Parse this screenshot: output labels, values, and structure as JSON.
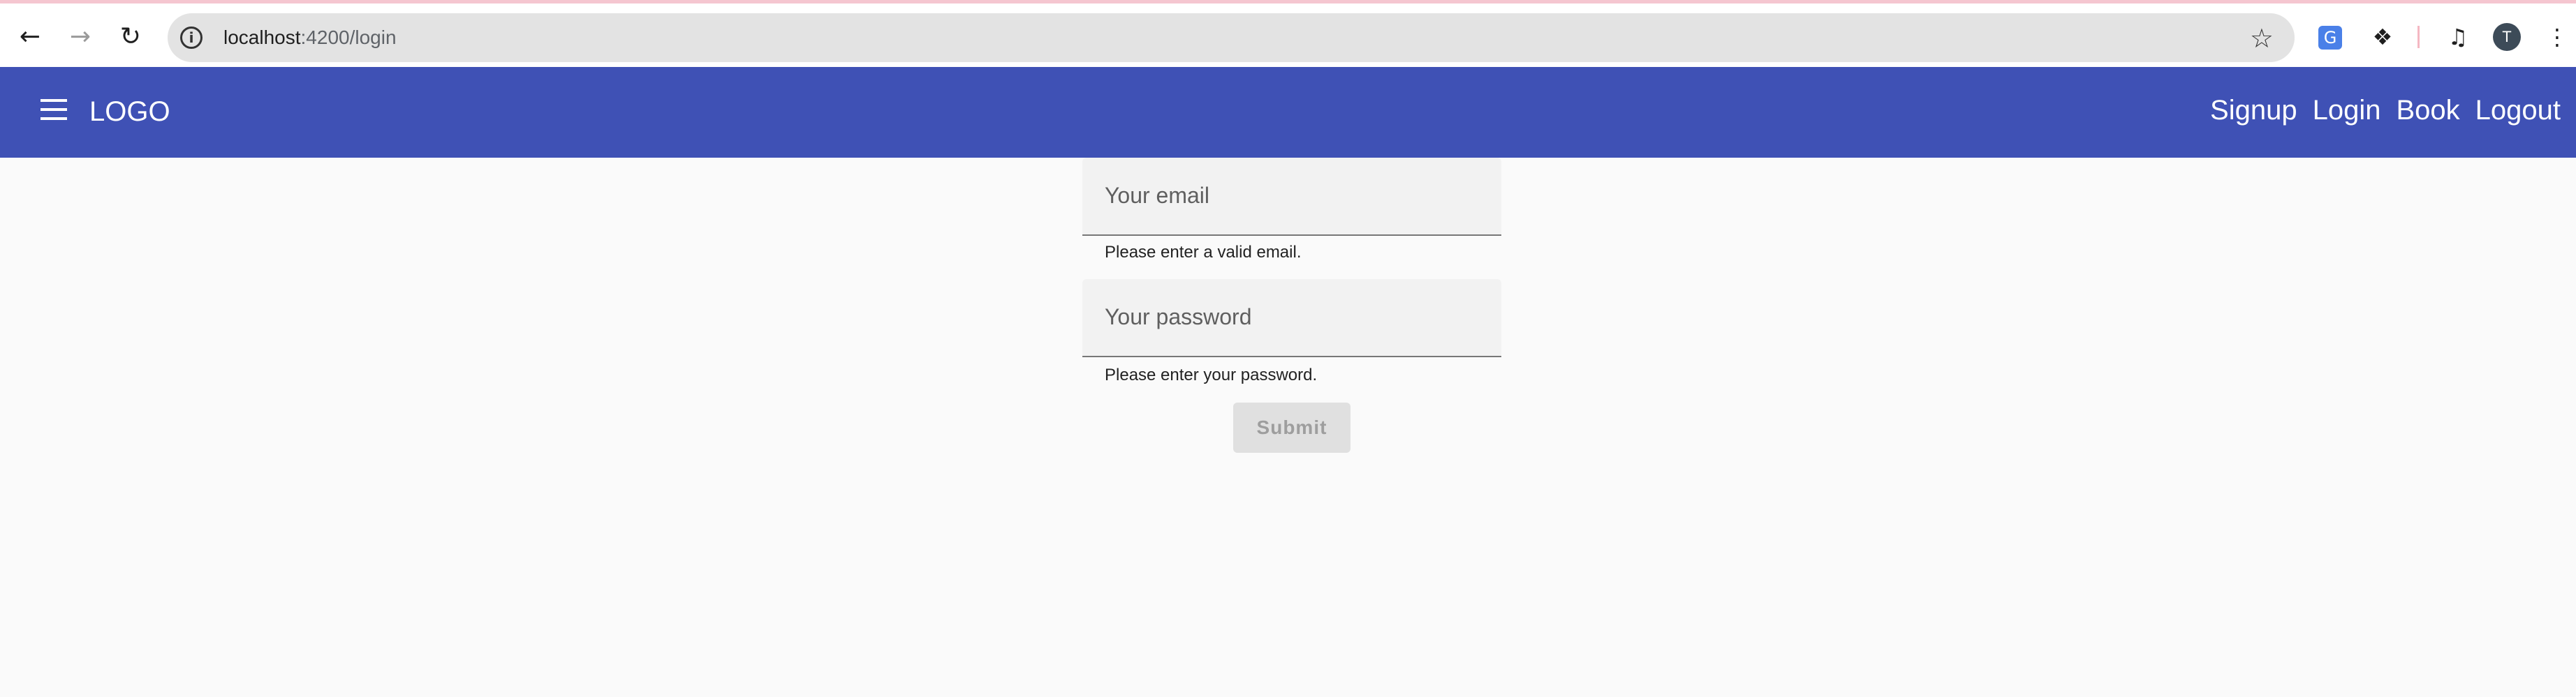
{
  "browser": {
    "url_host": "localhost",
    "url_path": ":4200/login",
    "profile_initial": "T"
  },
  "toolbar": {
    "logo": "LOGO",
    "links": [
      "Signup",
      "Login",
      "Book",
      "Logout"
    ]
  },
  "form": {
    "email_placeholder": "Your email",
    "email_hint": "Please enter a valid email.",
    "password_placeholder": "Your password",
    "password_hint": "Please enter your password.",
    "submit_label": "Submit"
  },
  "colors": {
    "primary": "#3f51b5",
    "background": "#fafafa",
    "disabled_button": "#e0e0e0"
  }
}
